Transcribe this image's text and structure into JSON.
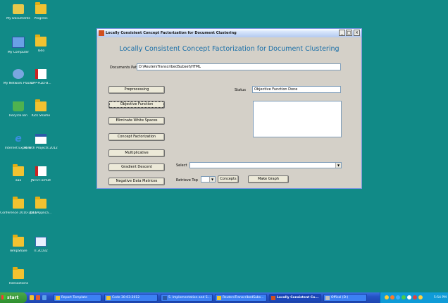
{
  "desktop_icons": [
    {
      "label": "My Documents",
      "kind": "folder"
    },
    {
      "label": "Progress",
      "kind": "folder"
    },
    {
      "label": "My Computer",
      "kind": "computer"
    },
    {
      "label": "Todo",
      "kind": "folder"
    },
    {
      "label": "My Network Places",
      "kind": "network"
    },
    {
      "label": "CPP-Puzz-B...",
      "kind": "pdf"
    },
    {
      "label": "Recycle Bin",
      "kind": "recycle"
    },
    {
      "label": "Kick Shame",
      "kind": "folder"
    },
    {
      "label": "Internet Explorer",
      "kind": "ie"
    },
    {
      "label": "M.Tech Projects 2012",
      "kind": "word"
    },
    {
      "label": "aaa",
      "kind": "folder"
    },
    {
      "label": "JNTU Format",
      "kind": "pdf"
    },
    {
      "label": "Conference 2010-2011",
      "kind": "folder"
    },
    {
      "label": "JavaApplica...",
      "kind": "folder"
    },
    {
      "label": "TempShare",
      "kind": "folder"
    },
    {
      "label": "IT.3C032",
      "kind": "doc"
    },
    {
      "label": "Transactions",
      "kind": "folder"
    }
  ],
  "window": {
    "title": "Locally Consistent Concept Factorization for Document Clustering",
    "controls": {
      "minimize": "_",
      "maximize": "□",
      "close": "×"
    }
  },
  "app": {
    "heading": "Locally Consistent Concept Factorization for Document Clustering",
    "doc_path_label": "Documents Path",
    "doc_path_value": "D:\\ReutersTranscribedSubset\\HTML",
    "status_label": "Status",
    "status_value": "Objective Function Done",
    "output_text": "",
    "buttons": {
      "preprocessing": "Preprocessing",
      "objective": "Objective Function",
      "eliminate": "Eliminate White Spaces",
      "concept": "Concept Factorization",
      "multiplicative": "Multiplicative",
      "gradient": "Gradient Descent",
      "negative": "Negative Data Matrices",
      "concepts": "Concepts",
      "make_graph": "Make Graph"
    },
    "select_label": "Select",
    "select_value": "",
    "retrieve_label": "Retrieve Top",
    "retrieve_value": ""
  },
  "taskbar": {
    "start": "start",
    "items": [
      {
        "label": "Report Template",
        "active": false
      },
      {
        "label": "Code 30-03-2012",
        "active": false
      },
      {
        "label": "5. Implementation and S...",
        "active": false
      },
      {
        "label": "ReutersTranscribedSubs...",
        "active": false
      },
      {
        "label": "Locally Consistent Co...",
        "active": true
      },
      {
        "label": "Offical (D:)",
        "active": false
      }
    ],
    "clock": "5:54 PM"
  }
}
